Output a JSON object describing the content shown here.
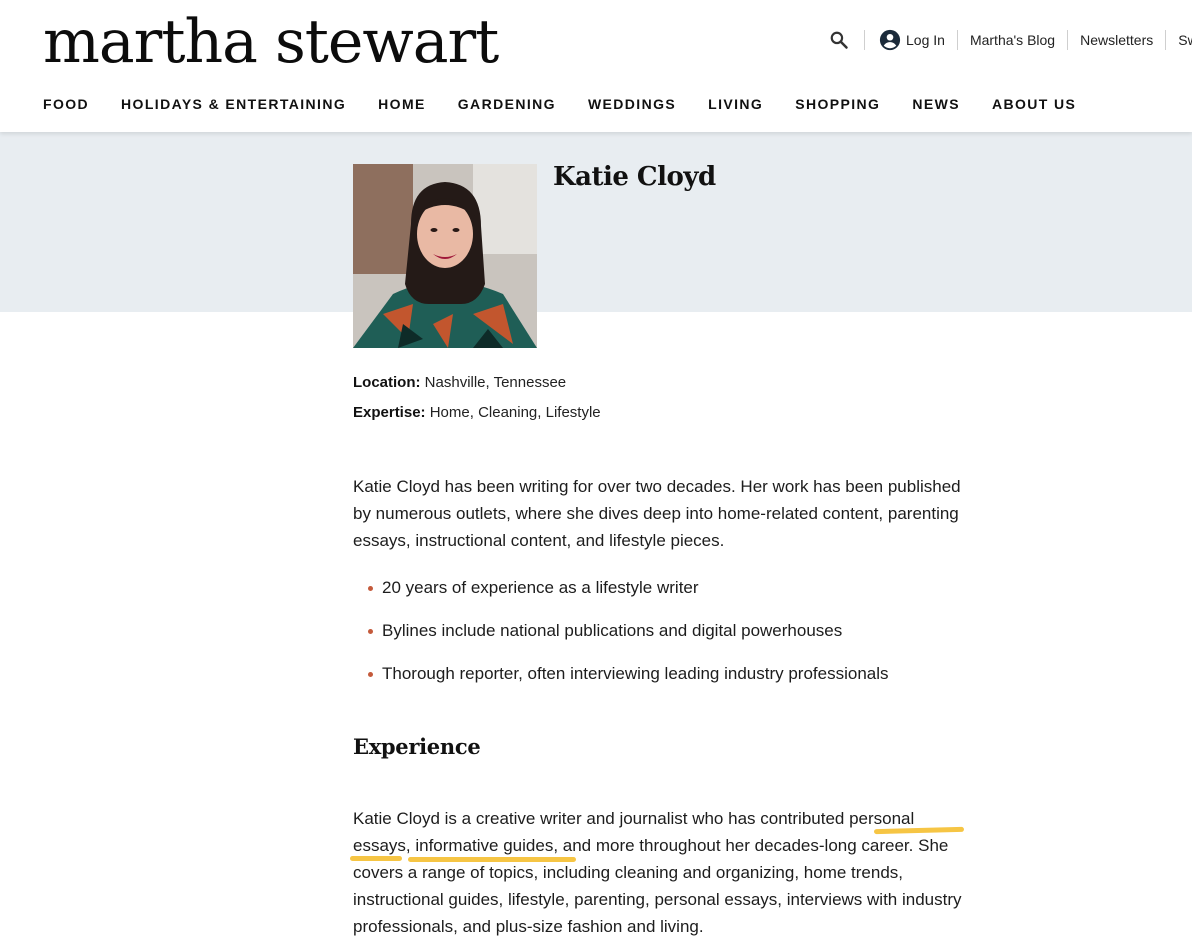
{
  "brand": {
    "logo_text": "martha stewart"
  },
  "utility": {
    "login_label": "Log In",
    "links": [
      "Martha's Blog",
      "Newsletters",
      "Sw"
    ]
  },
  "nav": {
    "items": [
      "FOOD",
      "HOLIDAYS & ENTERTAINING",
      "HOME",
      "GARDENING",
      "WEDDINGS",
      "LIVING",
      "SHOPPING",
      "NEWS",
      "ABOUT US"
    ]
  },
  "author": {
    "name": "Katie Cloyd",
    "location_label": "Location:",
    "location": "Nashville, Tennessee",
    "expertise_label": "Expertise:",
    "expertise": "Home, Cleaning, Lifestyle",
    "bio": "Katie Cloyd has been writing for over two decades. Her work has been published by numerous outlets, where she dives deep into home-related content, parenting essays, instructional content, and lifestyle pieces.",
    "highlights": [
      "20 years of experience as a lifestyle writer",
      "Bylines include national publications and digital powerhouses",
      "Thorough reporter, often interviewing leading industry professionals"
    ]
  },
  "experience": {
    "heading": "Experience",
    "text": "Katie Cloyd is a creative writer and journalist who has contributed personal essays, informative guides, and more throughout her decades-long career. She covers a range of topics, including cleaning and organizing, home trends, instructional guides, lifestyle, parenting, personal essays, interviews with industry professionals, and plus-size fashion and living."
  },
  "colors": {
    "hero_background": "#e8edf1",
    "bullet": "#c45a3b",
    "highlight": "#f5c23a"
  }
}
